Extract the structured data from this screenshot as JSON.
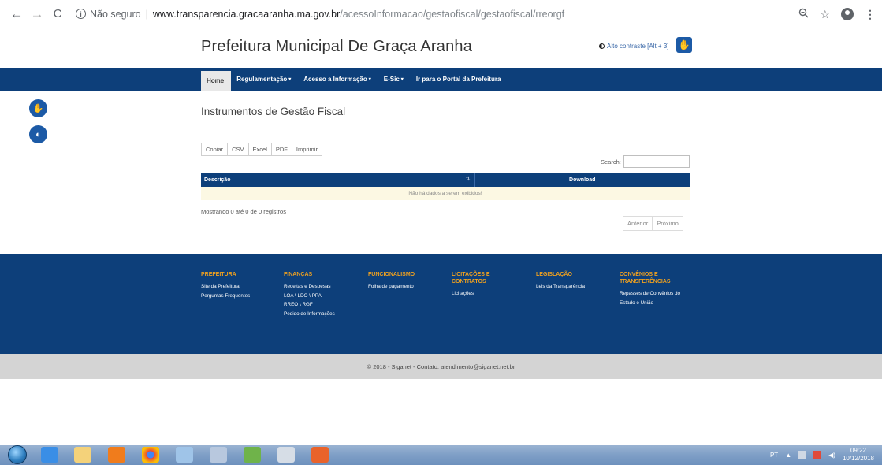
{
  "browser": {
    "security_label": "Não seguro",
    "url_host": "www.transparencia.gracaaranha.ma.gov.br",
    "url_path": "/acessoInformacao/gestaofiscal/gestaofiscal/rreorgf"
  },
  "header": {
    "title": "Prefeitura Municipal De Graça Aranha",
    "contrast_label": "Alto contraste [Alt + 3]"
  },
  "nav": {
    "items": [
      {
        "label": "Home",
        "caret": ""
      },
      {
        "label": "Regulamentação",
        "caret": "▾"
      },
      {
        "label": "Acesso a Informação",
        "caret": "▾"
      },
      {
        "label": "E-Sic",
        "caret": "▾"
      },
      {
        "label": "Ir para o Portal da Prefeitura",
        "caret": ""
      }
    ]
  },
  "main": {
    "heading": "Instrumentos de Gestão Fiscal",
    "export_buttons": [
      "Copiar",
      "CSV",
      "Excel",
      "PDF",
      "Imprimir"
    ],
    "search_label": "Search:",
    "search_value": "",
    "table": {
      "columns": [
        "Descrição",
        "Download"
      ],
      "empty_message": "Não há dados a serem exibidos!"
    },
    "info": "Mostrando 0 até 0 de 0 registros",
    "pager": {
      "prev": "Anterior",
      "next": "Próximo"
    }
  },
  "footer": {
    "columns": [
      {
        "heading": "PREFEITURA",
        "links": [
          "Site da Prefeitura",
          "Perguntas Frequentes"
        ]
      },
      {
        "heading": "FINANÇAS",
        "links": [
          "Receitas e Despesas",
          "LOA \\ LDO \\ PPA",
          "RREO \\ RGF",
          "Pedido de Informações"
        ]
      },
      {
        "heading": "FUNCIONALISMO",
        "links": [
          "Folha de pagamento"
        ]
      },
      {
        "heading": "LICITAÇÕES E CONTRATOS",
        "links": [
          "Licitações"
        ]
      },
      {
        "heading": "LEGISLAÇÃO",
        "links": [
          "Leis da Transparência"
        ]
      },
      {
        "heading": "CONVÊNIOS E TRANSFERÊNCIAS",
        "links": [
          "Repasses de Convênios do Estado e União"
        ]
      }
    ],
    "copyright": "© 2018 - Siganet - Contato: atendimento@siganet.net.br"
  },
  "taskbar": {
    "language": "PT",
    "time": "09:22",
    "date": "10/12/2018"
  },
  "colors": {
    "brand_blue": "#0d3f7a",
    "footer_heading": "#f0a11f",
    "empty_row": "#fcf8e3"
  }
}
